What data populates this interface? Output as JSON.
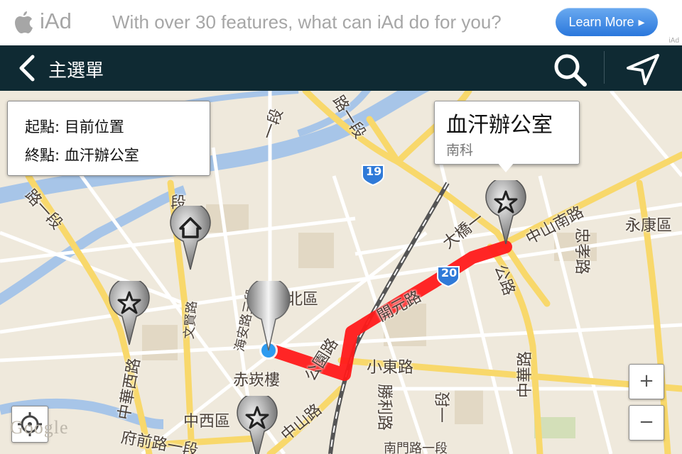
{
  "ad": {
    "brand": "iAd",
    "tagline": "With over 30 features, what can iAd do for you?",
    "cta": "Learn More",
    "tiny": "iAd"
  },
  "nav": {
    "back_label": "主選單",
    "icons": [
      "chevron-left-icon",
      "search-icon",
      "navigation-arrow-icon"
    ]
  },
  "route": {
    "start_label": "起點: 目前位置",
    "end_label": "終點: 血汗辦公室"
  },
  "callout": {
    "title": "血汗辦公室",
    "subtitle": "南科"
  },
  "map": {
    "attribution": "Google",
    "zoom_in": "+",
    "zoom_out": "−",
    "route_color": "#ff1a1a",
    "labels": {
      "north_district": "北區",
      "yongkang": "永康區",
      "chikan": "赤崁樓",
      "westcentral": "中西區",
      "zhongshan_s": "中山南路",
      "zhongxiao": "忠孝路",
      "kaiyuan": "開元路",
      "xiaodong": "小東路",
      "zhonghua_e": "中華路",
      "zhonghua_w": "中華西路",
      "fuqian": "府前路一段",
      "zhongshan": "中山路",
      "gongyuan": "公園路",
      "shengli": "勝利路",
      "haian": "海安路三段",
      "wenxian": "文賢路",
      "daqiao": "大橋一",
      "rd_top": "路一段",
      "rd_left": "路一段",
      "rd_mid": "一段",
      "duan": "段",
      "yiduan": "一段",
      "gongyuan_n": "公路",
      "nanmen": "南門路一段"
    },
    "shields": [
      "19",
      "20"
    ]
  }
}
